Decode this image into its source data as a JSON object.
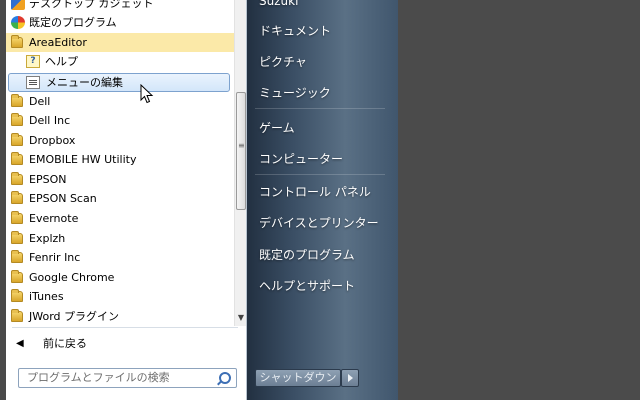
{
  "programs": {
    "items": [
      {
        "label": "デスクトップ ガジェット",
        "icon": "gadget-icon"
      },
      {
        "label": "既定のプログラム",
        "icon": "default-programs-icon"
      },
      {
        "label": "AreaEditor",
        "icon": "folder-icon"
      },
      {
        "label": "ヘルプ",
        "icon": "help-icon"
      },
      {
        "label": "メニューの編集",
        "icon": "edit-menu-icon"
      },
      {
        "label": "Dell",
        "icon": "folder-icon"
      },
      {
        "label": "Dell Inc",
        "icon": "folder-icon"
      },
      {
        "label": "Dropbox",
        "icon": "folder-icon"
      },
      {
        "label": "EMOBILE HW Utility",
        "icon": "folder-icon"
      },
      {
        "label": "EPSON",
        "icon": "folder-icon"
      },
      {
        "label": "EPSON Scan",
        "icon": "folder-icon"
      },
      {
        "label": "Evernote",
        "icon": "folder-icon"
      },
      {
        "label": "Explzh",
        "icon": "folder-icon"
      },
      {
        "label": "Fenrir Inc",
        "icon": "folder-icon"
      },
      {
        "label": "Google Chrome",
        "icon": "folder-icon"
      },
      {
        "label": "iTunes",
        "icon": "folder-icon"
      },
      {
        "label": "JWord プラグイン",
        "icon": "folder-icon"
      }
    ],
    "back_label": "前に戻る"
  },
  "search": {
    "placeholder": "プログラムとファイルの検索"
  },
  "right": {
    "user": "Suzuki",
    "items": [
      "ドキュメント",
      "ピクチャ",
      "ミュージック",
      "ゲーム",
      "コンピューター",
      "コントロール パネル",
      "デバイスとプリンター",
      "既定のプログラム",
      "ヘルプとサポート"
    ],
    "shutdown_label": "シャットダウン"
  },
  "colors": {
    "highlight_folder": "#fbe9a8",
    "hover_row": "#d3e6fa",
    "panel_dark": "#3a4e64"
  }
}
